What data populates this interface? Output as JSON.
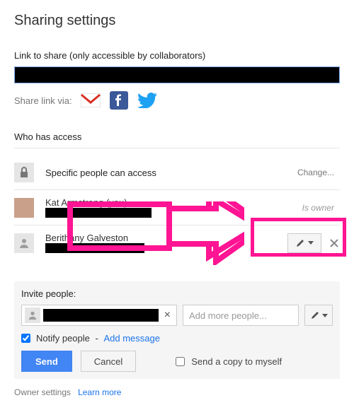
{
  "title": "Sharing settings",
  "link_section": {
    "label": "Link to share (only accessible by collaborators)",
    "share_via_label": "Share link via:"
  },
  "access": {
    "heading": "Who has access",
    "rows": {
      "scope": {
        "text": "Specific people can access",
        "action": "Change..."
      },
      "owner": {
        "name": "Kat Armstrong (you)",
        "role": "Is owner"
      },
      "collab": {
        "name": "Berithany Galveston"
      }
    }
  },
  "invite": {
    "label": "Invite people:",
    "more_placeholder": "Add more people...",
    "notify_label": "Notify people",
    "add_message": "Add message",
    "send": "Send",
    "cancel": "Cancel",
    "send_copy": "Send a copy to myself"
  },
  "footer": {
    "owner_settings": "Owner settings",
    "learn_more": "Learn more"
  },
  "icons": {
    "gmail": "gmail-icon",
    "facebook": "facebook-icon",
    "twitter": "twitter-icon",
    "person": "person-icon",
    "pencil": "pencil-icon",
    "caret": "caret-down-icon",
    "close": "close-icon"
  }
}
